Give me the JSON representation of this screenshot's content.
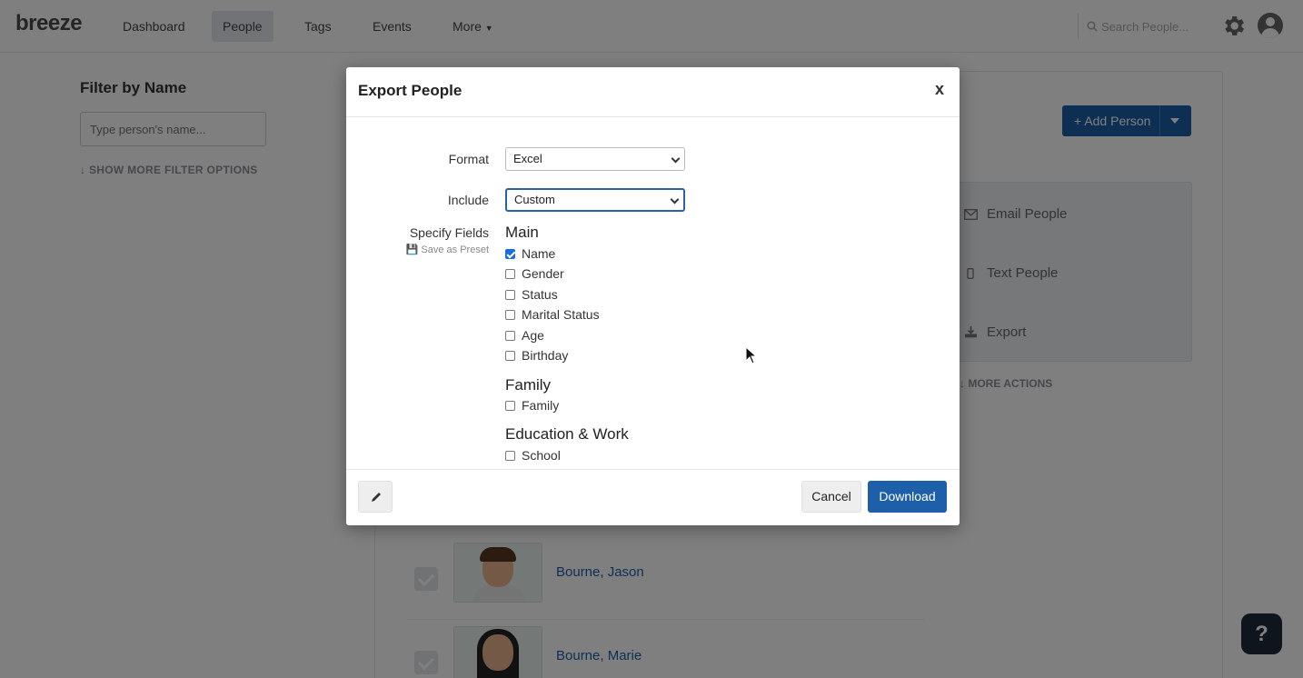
{
  "nav": {
    "logo": "breeze",
    "items": [
      {
        "label": "Dashboard"
      },
      {
        "label": "People",
        "active": true
      },
      {
        "label": "Tags"
      },
      {
        "label": "Events"
      },
      {
        "label": "More"
      }
    ],
    "search_placeholder": "Search People..."
  },
  "filter": {
    "title": "Filter by Name",
    "input_placeholder": "Type person's name...",
    "more_options": "SHOW MORE FILTER OPTIONS"
  },
  "main": {
    "add_person": "Add Person",
    "actions": [
      {
        "label": "Email People",
        "icon": "envelope-icon"
      },
      {
        "label": "Text People",
        "icon": "phone-icon"
      },
      {
        "label": "Export",
        "icon": "download-icon"
      }
    ],
    "more_actions": "MORE ACTIONS",
    "people": [
      {
        "name": "Bourne, Jason"
      },
      {
        "name": "Bourne, Marie"
      }
    ]
  },
  "modal": {
    "title": "Export People",
    "close": "x",
    "format_label": "Format",
    "format_value": "Excel",
    "include_label": "Include",
    "include_value": "Custom",
    "fields_label": "Specify Fields",
    "save_preset": "Save as Preset",
    "groups": {
      "main": {
        "title": "Main",
        "fields": [
          {
            "label": "Name",
            "checked": true
          },
          {
            "label": "Gender",
            "checked": false
          },
          {
            "label": "Status",
            "checked": false
          },
          {
            "label": "Marital Status",
            "checked": false
          },
          {
            "label": "Age",
            "checked": false
          },
          {
            "label": "Birthday",
            "checked": false
          }
        ]
      },
      "family": {
        "title": "Family",
        "fields": [
          {
            "label": "Family",
            "checked": false
          }
        ]
      },
      "education": {
        "title": "Education & Work",
        "fields": [
          {
            "label": "School",
            "checked": false
          }
        ]
      }
    },
    "cancel": "Cancel",
    "download": "Download"
  },
  "colors": {
    "primary": "#1d5fa8",
    "checkbox_checked": "#1a6fe0",
    "overlay": "rgba(0,0,0,0.5)"
  },
  "help": "?"
}
